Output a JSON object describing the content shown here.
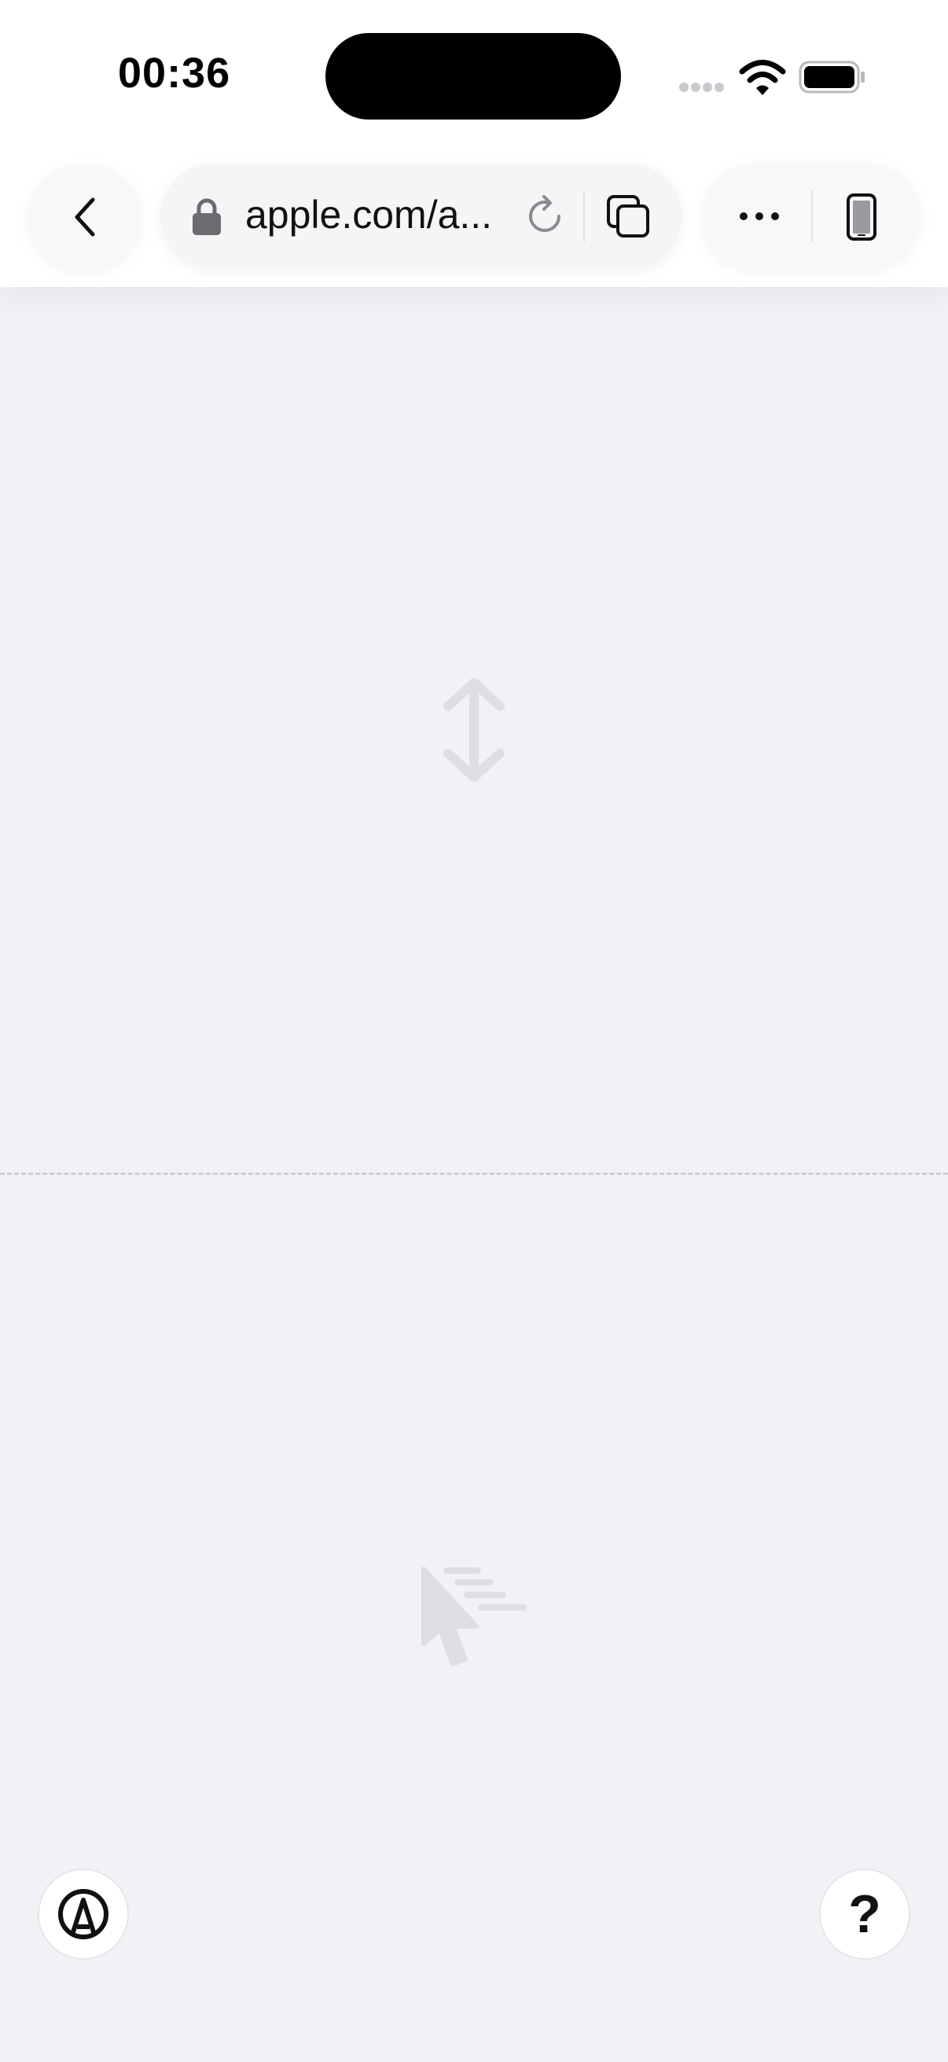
{
  "status_bar": {
    "time": "00:36"
  },
  "browser": {
    "url": "apple.com/a..."
  },
  "help_button": {
    "label": "?"
  },
  "colors": {
    "background": "#f1f1f6",
    "toolbar": "#ffffff",
    "icon_faint": "#dedee3"
  },
  "icons": {
    "back": "chevron-left-icon",
    "lock": "lock-icon",
    "reload": "reload-icon",
    "tabs": "tabs-icon",
    "more": "more-icon",
    "device": "iphone-icon",
    "scroll": "vertical-scroll-icon",
    "cursor": "fast-cursor-icon",
    "markup": "markup-pen-icon"
  }
}
